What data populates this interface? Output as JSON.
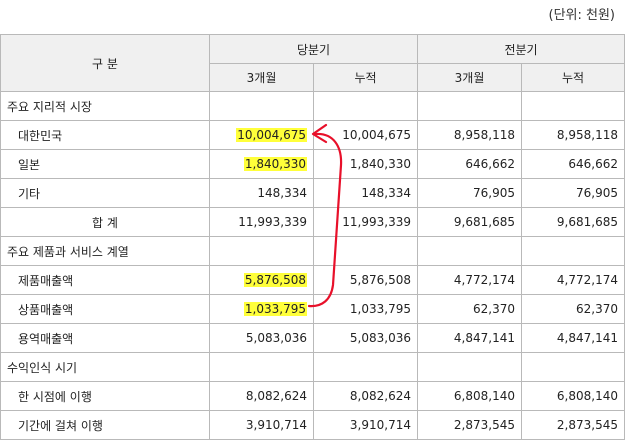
{
  "unit_note": "(단위: 천원)",
  "header": {
    "col_label": "구 분",
    "current_period": "당분기",
    "prior_period": "전분기",
    "sub_3m": "3개월",
    "sub_cum": "누적"
  },
  "rows": [
    {
      "label": "주요 지리적 시장",
      "type": "section",
      "values": [
        "",
        "",
        "",
        ""
      ]
    },
    {
      "label": "대한민국",
      "type": "item",
      "values": [
        "10,004,675",
        "10,004,675",
        "8,958,118",
        "8,958,118"
      ],
      "highlight": true
    },
    {
      "label": "일본",
      "type": "item",
      "values": [
        "1,840,330",
        "1,840,330",
        "646,662",
        "646,662"
      ],
      "highlight": true
    },
    {
      "label": "기타",
      "type": "item",
      "values": [
        "148,334",
        "148,334",
        "76,905",
        "76,905"
      ],
      "highlight": false
    },
    {
      "label": "합 계",
      "type": "total",
      "values": [
        "11,993,339",
        "11,993,339",
        "9,681,685",
        "9,681,685"
      ],
      "highlight": false
    },
    {
      "label": "주요 제품과 서비스 계열",
      "type": "section",
      "values": [
        "",
        "",
        "",
        ""
      ]
    },
    {
      "label": "제품매출액",
      "type": "item",
      "values": [
        "5,876,508",
        "5,876,508",
        "4,772,174",
        "4,772,174"
      ],
      "highlight": true
    },
    {
      "label": "상품매출액",
      "type": "item",
      "values": [
        "1,033,795",
        "1,033,795",
        "62,370",
        "62,370"
      ],
      "highlight": true
    },
    {
      "label": "용역매출액",
      "type": "item",
      "values": [
        "5,083,036",
        "5,083,036",
        "4,847,141",
        "4,847,141"
      ],
      "highlight": false
    },
    {
      "label": "수익인식 시기",
      "type": "section",
      "values": [
        "",
        "",
        "",
        ""
      ]
    },
    {
      "label": "한 시점에 이행",
      "type": "item",
      "values": [
        "8,082,624",
        "8,082,624",
        "6,808,140",
        "6,808,140"
      ],
      "highlight": false
    },
    {
      "label": "기간에 걸쳐 이행",
      "type": "item",
      "values": [
        "3,910,714",
        "3,910,714",
        "2,873,545",
        "2,873,545"
      ],
      "highlight": false
    }
  ],
  "annotation_color": "#e8102a",
  "highlight_color": "#ffff3a"
}
